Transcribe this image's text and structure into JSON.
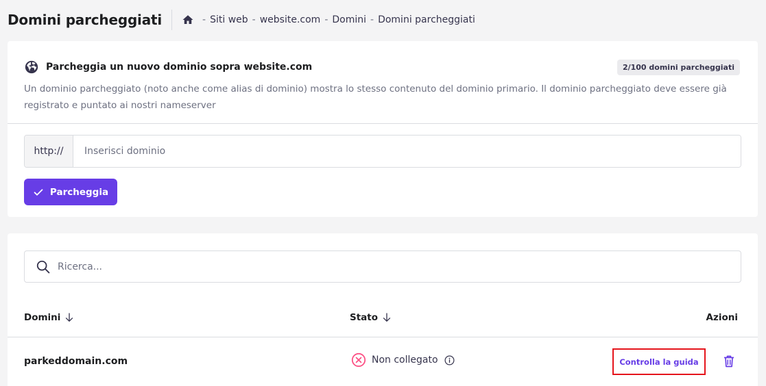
{
  "header": {
    "title": "Domini parcheggiati",
    "breadcrumb": [
      "Siti web",
      "website.com",
      "Domini",
      "Domini parcheggiati"
    ],
    "separator": "-"
  },
  "park_card": {
    "title": "Parcheggia un nuovo dominio sopra website.com",
    "badge": "2/100 domini parcheggiati",
    "description": "Un dominio parcheggiato (noto anche come alias di dominio) mostra lo stesso contenuto del dominio primario. Il dominio parcheggiato deve essere già registrato e puntato ai nostri nameserver",
    "input_prefix": "http://",
    "input_placeholder": "Inserisci dominio",
    "input_value": "",
    "submit_label": "Parcheggia"
  },
  "list_card": {
    "search_placeholder": "Ricerca...",
    "columns": {
      "domains": "Domini",
      "status": "Stato",
      "actions": "Azioni"
    },
    "rows": [
      {
        "domain": "parkeddomain.com",
        "status": "Non collegato",
        "action_label": "Controlla la guida"
      }
    ]
  },
  "colors": {
    "accent": "#673de6",
    "error": "#e5141b",
    "status_error": "#fc5185"
  }
}
